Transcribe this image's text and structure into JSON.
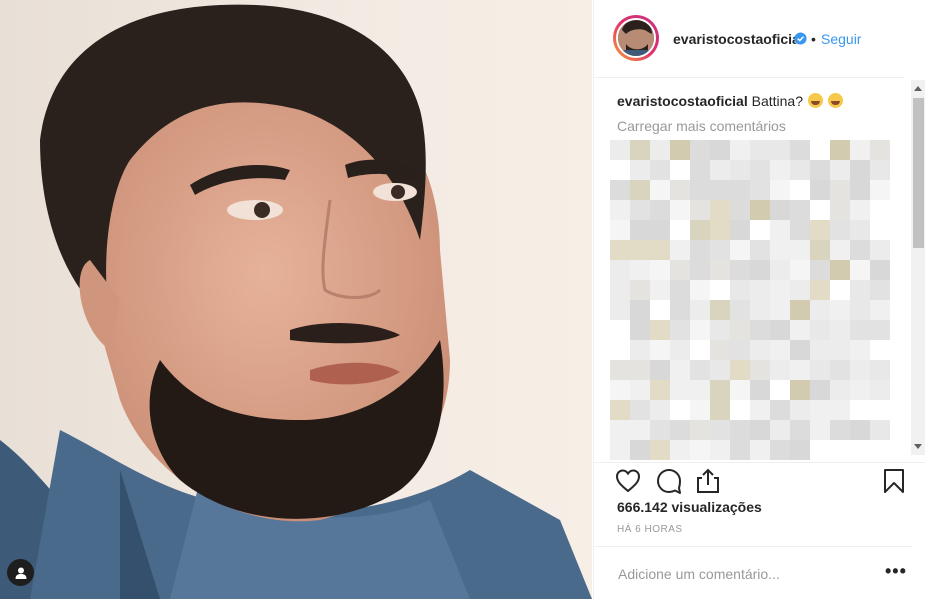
{
  "post": {
    "username": "evaristocostaoficial",
    "follow_label": "Seguir",
    "dot_separator": "•",
    "caption_user": "evaristocostaoficial",
    "caption_text": "Battina?",
    "caption_emojis": [
      "rolling-on-floor-laughing-emoji",
      "grinning-squinting-emoji"
    ],
    "load_more_label": "Carregar mais comentários",
    "views_count": "666.142",
    "views_label": "visualizações",
    "timestamp": "HÁ 6 HORAS",
    "comment_placeholder": "Adicione um comentário...",
    "more_label": "•••"
  },
  "icons": {
    "like": "heart-icon",
    "comment": "comment-bubble-icon",
    "share": "share-icon",
    "save": "bookmark-icon",
    "user_tags": "user-icon",
    "verified": "verified-badge-icon"
  },
  "colors": {
    "link": "#3897f0",
    "verified": "#3897f0",
    "muted": "#999999",
    "text": "#262626"
  }
}
